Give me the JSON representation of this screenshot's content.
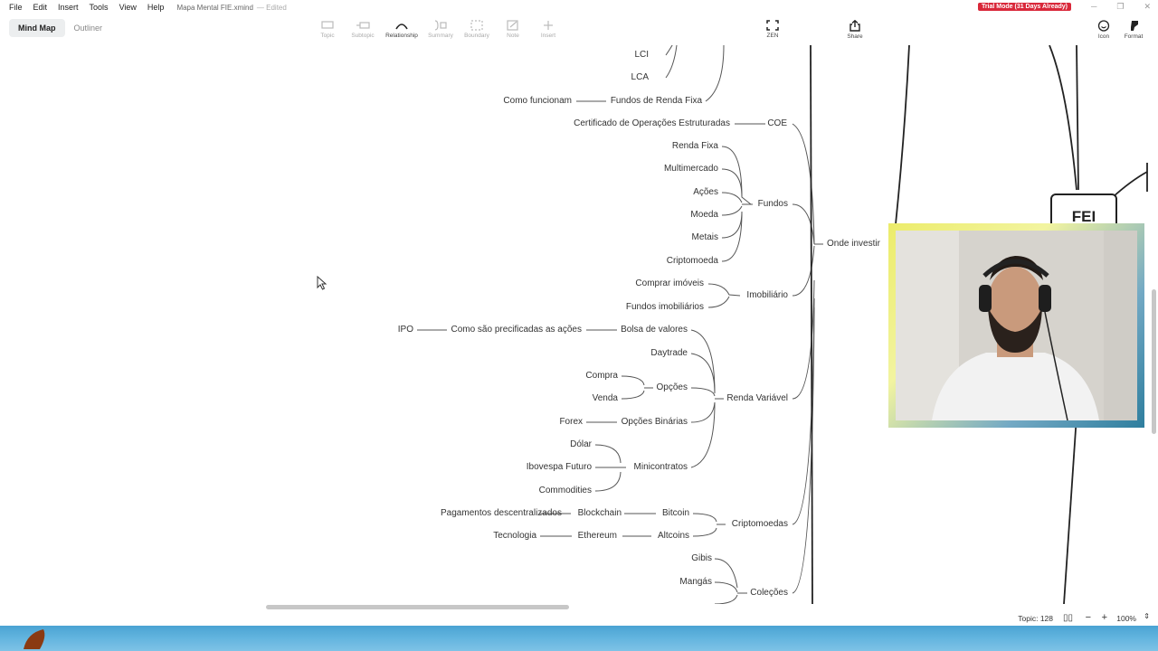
{
  "menubar": {
    "items": [
      "File",
      "Edit",
      "Insert",
      "Tools",
      "View",
      "Help"
    ],
    "doc_title": "Mapa Mental FIE.xmind",
    "doc_status": "— Edited",
    "trial_badge": "Trial Mode (31 Days Already)"
  },
  "toolbar": {
    "view_tabs": [
      "Mind Map",
      "Outliner"
    ],
    "active_tab": "Mind Map",
    "tools": {
      "topic": "Topic",
      "subtopic": "Subtopic",
      "relationship": "Relationship",
      "summary": "Summary",
      "boundary": "Boundary",
      "note": "Note",
      "insert": "Insert",
      "zen": "ZEN",
      "share": "Share",
      "icon": "Icon",
      "format": "Format"
    }
  },
  "mindmap": {
    "central": "FEI",
    "topics": {
      "lci": "LCI",
      "lca": "LCA",
      "como_funcionam": "Como funcionam",
      "fundos_renda_fixa": "Fundos de Renda Fixa",
      "certificado": "Certificado de Operações Estruturadas",
      "coe": "COE",
      "renda_fixa": "Renda Fixa",
      "multimercado": "Multimercado",
      "acoes": "Ações",
      "moeda": "Moeda",
      "metais": "Metais",
      "criptomoeda": "Criptomoeda",
      "fundos": "Fundos",
      "onde_investir": "Onde investir",
      "comprar_imoveis": "Comprar imóveis",
      "fundos_imobiliarios": "Fundos imobiliários",
      "imobiliario": "Imobiliário",
      "ipo": "IPO",
      "como_sao_precificadas": "Como são precificadas as ações",
      "bolsa_valores": "Bolsa de valores",
      "daytrade": "Daytrade",
      "compra": "Compra",
      "venda": "Venda",
      "opcoes": "Opções",
      "renda_variavel": "Renda Variável",
      "forex": "Forex",
      "opcoes_binarias": "Opções Binárias",
      "dolar": "Dólar",
      "ibovespa_futuro": "Ibovespa Futuro",
      "commodities": "Commodities",
      "minicontratos": "Minicontratos",
      "pagamentos": "Pagamentos descentralizados",
      "blockchain": "Blockchain",
      "bitcoin": "Bitcoin",
      "tecnologia": "Tecnologia",
      "ethereum": "Ethereum",
      "altcoins": "Altcoins",
      "criptomoedas": "Criptomoedas",
      "gibis": "Gibis",
      "mangas": "Mangás",
      "colecoes": "Coleções"
    }
  },
  "statusbar": {
    "topic_count": "Topic: 128",
    "zoom": "100%"
  },
  "colors": {
    "trial_badge": "#d9283a",
    "line": "#555555",
    "taskbar": "#5aaede"
  }
}
